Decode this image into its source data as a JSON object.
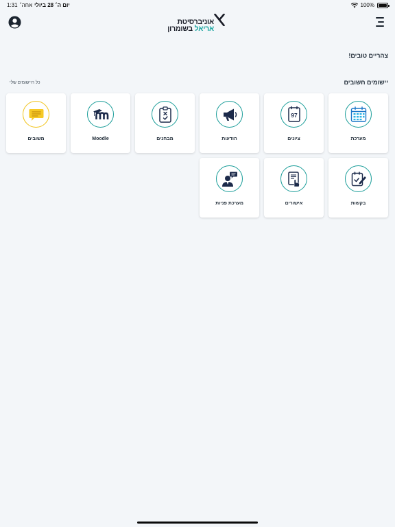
{
  "status_bar": {
    "time": "1:31",
    "ampm": "אחה׳",
    "date": "יום ה׳ 28 ביולי",
    "battery": "100%",
    "battery_level": 1.0
  },
  "header": {
    "logo_line1": "אוניברסיטת",
    "logo_line2_a": "אריאל",
    "logo_line2_b": "בשומרון"
  },
  "greeting": "צהריים טובים!",
  "apps_section": {
    "title": "יישומים חשובים",
    "all_apps_link": "כל היישומים שלי",
    "tiles": [
      {
        "label": "מערכת",
        "icon": "calendar-icon"
      },
      {
        "label": "ציונים",
        "icon": "grades-icon"
      },
      {
        "label": "הודעות",
        "icon": "megaphone-icon"
      },
      {
        "label": "מבחנים",
        "icon": "exam-clipboard-icon"
      },
      {
        "label": "Moodle",
        "icon": "moodle-icon"
      },
      {
        "label": "משובים",
        "icon": "feedback-chat-icon"
      },
      {
        "label": "בקשות",
        "icon": "requests-edit-icon"
      },
      {
        "label": "אישורים",
        "icon": "approvals-icon"
      },
      {
        "label": "מערכת פניות",
        "icon": "support-inquiries-icon"
      }
    ],
    "grade_number": "97"
  },
  "colors": {
    "teal": "#1a9d99",
    "navy": "#1c2a4a",
    "yellow": "#f1c318",
    "background": "#f3f6f9"
  }
}
